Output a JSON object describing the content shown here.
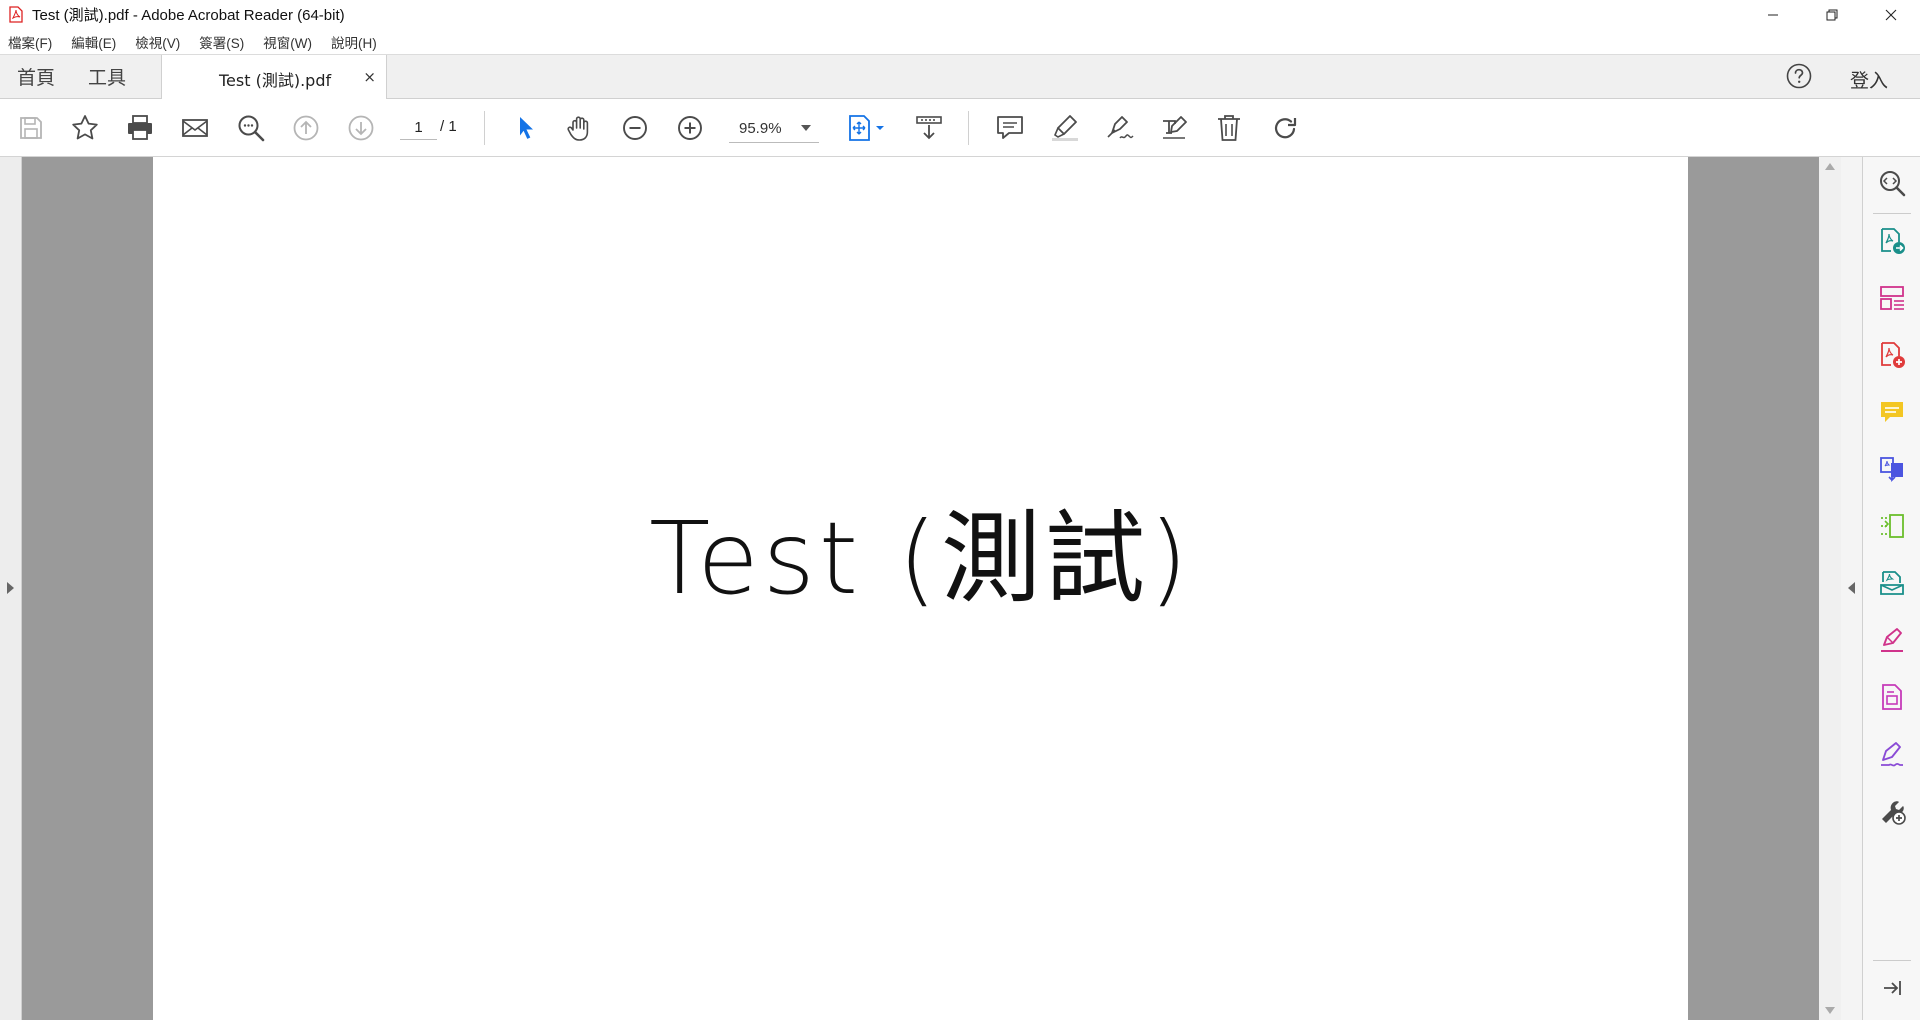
{
  "window": {
    "title": "Test (測試).pdf - Adobe Acrobat Reader (64-bit)"
  },
  "menu": {
    "items": [
      "檔案(F)",
      "編輯(E)",
      "檢視(V)",
      "簽署(S)",
      "視窗(W)",
      "說明(H)"
    ]
  },
  "tabs": {
    "home": "首頁",
    "tools": "工具",
    "document": "Test (測試).pdf",
    "close_glyph": "×",
    "sign_in": "登入"
  },
  "toolbar": {
    "current_page": "1",
    "total_pages": "/ 1",
    "zoom": "95.9%"
  },
  "document": {
    "text": "Test (測試)"
  },
  "colors": {
    "accent_blue": "#1473e6",
    "pdf_red": "#e03b3b",
    "icon_gray": "#4b4b4b",
    "disabled_gray": "#b5b5b5"
  },
  "icons": {
    "right_pane": [
      "search-zoom-icon",
      "export-pdf-icon",
      "organize-pages-icon",
      "create-pdf-icon",
      "comment-icon",
      "convert-pdf-icon",
      "compress-pdf-icon",
      "send-for-review-icon",
      "fill-sign-icon",
      "edit-pdf-icon",
      "request-signature-icon",
      "more-tools-icon"
    ]
  }
}
